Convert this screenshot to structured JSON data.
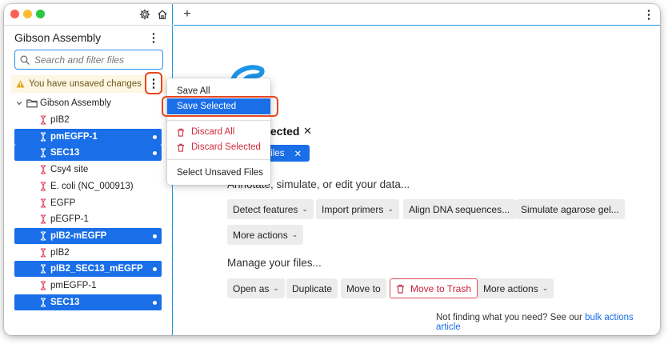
{
  "sidebar": {
    "title": "Gibson Assembly",
    "search_placeholder": "Search and filter files",
    "unsaved_warning": "You have unsaved changes",
    "folder": "Gibson Assembly",
    "files": [
      {
        "name": "pIB2",
        "selected": false
      },
      {
        "name": "pmEGFP-1",
        "selected": true
      },
      {
        "name": "SEC13",
        "selected": true
      },
      {
        "name": "Csy4 site",
        "selected": false
      },
      {
        "name": "E. coli (NC_000913)",
        "selected": false
      },
      {
        "name": "EGFP",
        "selected": false
      },
      {
        "name": "pEGFP-1",
        "selected": false
      },
      {
        "name": "pIB2-mEGFP",
        "selected": true
      },
      {
        "name": "pIB2",
        "selected": false
      },
      {
        "name": "pIB2_SEC13_mEGFP",
        "selected": true
      },
      {
        "name": "pmEGFP-1",
        "selected": false
      },
      {
        "name": "SEC13",
        "selected": true
      }
    ]
  },
  "menu": {
    "save_all": "Save All",
    "save_selected": "Save Selected",
    "discard_all": "Discard All",
    "discard_selected": "Discard Selected",
    "select_unsaved": "Select Unsaved Files"
  },
  "main": {
    "selected_heading": "lected",
    "chip_label": "files",
    "annotate_label": "Annotate, simulate, or edit your data...",
    "buttons_row1": [
      "Detect features",
      "Import primers",
      "Align DNA sequences...",
      "Simulate agarose gel..."
    ],
    "more_actions": "More actions",
    "manage_label": "Manage your files...",
    "buttons_row3": {
      "open_as": "Open as",
      "duplicate": "Duplicate",
      "move_to": "Move to",
      "move_to_trash": "Move to Trash",
      "more_actions": "More actions"
    },
    "footer_text": "Not finding what you need? See our",
    "footer_link": "bulk actions article"
  },
  "colors": {
    "accent": "#1a6ee8",
    "highlight_ring": "#e8451f",
    "danger": "#d0283c",
    "warning_bg": "#fdf6e2"
  }
}
